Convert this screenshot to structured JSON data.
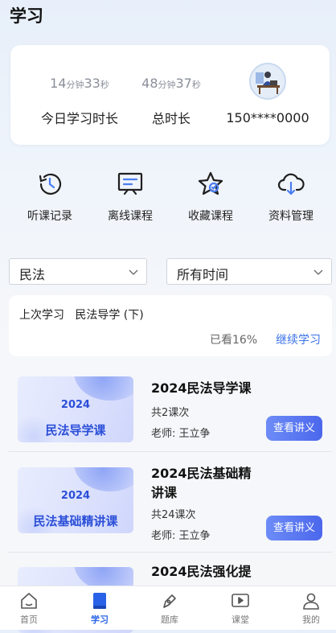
{
  "page_title": "学习",
  "stats": {
    "today": {
      "minutes": "14",
      "min_unit": "分钟",
      "seconds": "33",
      "sec_unit": "秒",
      "label": "今日学习时长"
    },
    "total": {
      "minutes": "48",
      "min_unit": "分钟",
      "seconds": "37",
      "sec_unit": "秒",
      "label": "总时长"
    },
    "user": {
      "phone": "150****0000",
      "avatar": "user-avatar"
    }
  },
  "actions": [
    {
      "label": "听课记录",
      "icon": "history-icon"
    },
    {
      "label": "离线课程",
      "icon": "offline-course-icon"
    },
    {
      "label": "收藏课程",
      "icon": "favorite-icon"
    },
    {
      "label": "资料管理",
      "icon": "cloud-download-icon"
    }
  ],
  "filters": {
    "subject": "民法",
    "time": "所有时间"
  },
  "last_study": {
    "label": "上次学习",
    "course": "民法导学 (下)",
    "progress": "已看16%",
    "continue": "继续学习"
  },
  "courses": [
    {
      "thumb_year": "2024",
      "thumb_title": "民法导学课",
      "name": "2024民法导学课",
      "count": "共2课次",
      "teacher": "老师: 王立争",
      "button": "查看讲义"
    },
    {
      "thumb_year": "2024",
      "thumb_title": "民法基础精讲课",
      "name": "2024民法基础精讲课",
      "count": "共24课次",
      "teacher": "老师: 王立争",
      "button": "查看讲义"
    },
    {
      "thumb_year": "",
      "thumb_title": "",
      "name": "2024民法强化提",
      "count": "",
      "teacher": "",
      "button": ""
    }
  ],
  "bottom_nav": [
    {
      "label": "首页",
      "icon": "home-icon",
      "active": false
    },
    {
      "label": "学习",
      "icon": "study-book-icon",
      "active": true
    },
    {
      "label": "题库",
      "icon": "question-bank-icon",
      "active": false
    },
    {
      "label": "课堂",
      "icon": "classroom-play-icon",
      "active": false
    },
    {
      "label": "我的",
      "icon": "profile-icon",
      "active": false
    }
  ],
  "colors": {
    "accent": "#2962e6",
    "link": "#3a73e8",
    "button_start": "#6d8cf7",
    "button_end": "#4b67ec"
  }
}
